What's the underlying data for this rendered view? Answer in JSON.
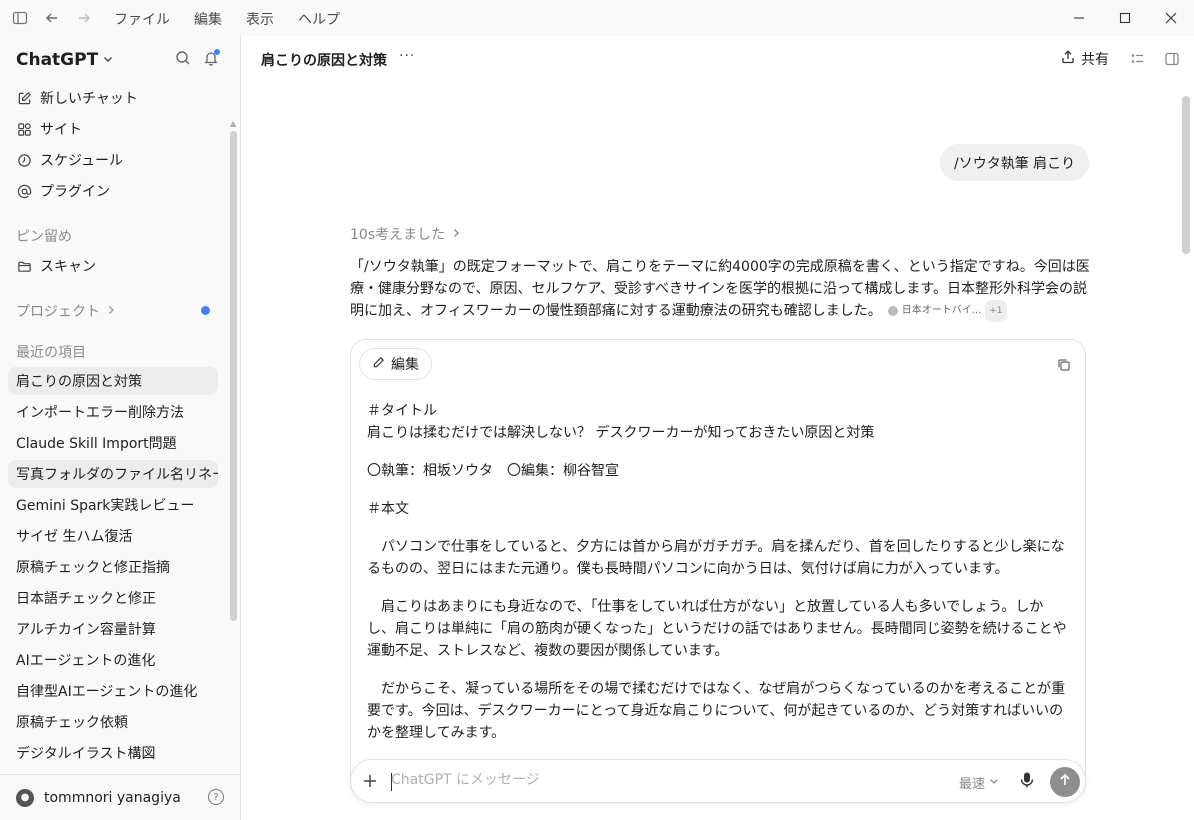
{
  "titlebar": {
    "menu": [
      "ファイル",
      "編集",
      "表示",
      "ヘルプ"
    ]
  },
  "sidebar": {
    "brand": "ChatGPT",
    "nav": [
      {
        "label": "新しいチャット",
        "icon": "new-chat-icon"
      },
      {
        "label": "サイト",
        "icon": "sites-icon"
      },
      {
        "label": "スケジュール",
        "icon": "clock-icon"
      },
      {
        "label": "プラグイン",
        "icon": "at-icon"
      }
    ],
    "pinned_header": "ピン留め",
    "pinned": [
      {
        "label": "スキャン",
        "icon": "folder-icon"
      }
    ],
    "projects_header": "プロジェクト",
    "recent_header": "最近の項目",
    "recent": [
      "肩こりの原因と対策",
      "インポートエラー削除方法",
      "Claude Skill Import問題",
      "写真フォルダのファイル名リネーム",
      "Gemini Spark実践レビュー",
      "サイゼ 生ハム復活",
      "原稿チェックと修正指摘",
      "日本語チェックと修正",
      "アルチカイン容量計算",
      "AIエージェントの進化",
      "自律型AIエージェントの進化",
      "原稿チェック依頼",
      "デジタルイラスト構図"
    ],
    "user_name": "tommnori yanagiya"
  },
  "main": {
    "title": "肩こりの原因と対策",
    "more": "···",
    "share": "共有",
    "user_message": "/ソウタ執筆 肩こり",
    "thought": "10s考えました",
    "answer": "「/ソウタ執筆」の既定フォーマットで、肩こりをテーマに約4000字の完成原稿を書く、という指定ですね。今回は医療・健康分野なので、原因、セルフケア、受診すべきサインを医学的根拠に沿って構成します。日本整形外科学会の説明に加え、オフィスワーカーの慢性頚部痛に対する運動療法の研究も確認しました。",
    "citation": "日本オートバイ...",
    "citation_more": "+1",
    "canvas": {
      "edit_label": "編集",
      "lines": [
        "＃タイトル",
        "肩こりは揉むだけでは解決しない？ デスクワーカーが知っておきたい原因と対策",
        "〇執筆：相坂ソウタ　〇編集：柳谷智宣",
        "＃本文",
        "　パソコンで仕事をしていると、夕方には首から肩がガチガチ。肩を揉んだり、首を回したりすると少し楽になるものの、翌日にはまた元通り。僕も長時間パソコンに向かう日は、気付けば肩に力が入っています。",
        "　肩こりはあまりにも身近なので、「仕事をしていれば仕方がない」と放置している人も多いでしょう。しかし、肩こりは単純に「肩の筋肉が硬くなった」というだけの話ではありません。長時間同じ姿勢を続けることや運動不足、ストレスなど、複数の要因が関係しています。",
        "　だからこそ、凝っている場所をその場で揉むだけではなく、なぜ肩がつらくなっているのかを考えることが重要です。今回は、デスクワーカーにとって身近な肩こりについて、何が起きているのか、どう対策すればいいのかを整理してみます。"
      ]
    },
    "composer": {
      "placeholder": "ChatGPT にメッセージ",
      "speed": "最速"
    }
  }
}
